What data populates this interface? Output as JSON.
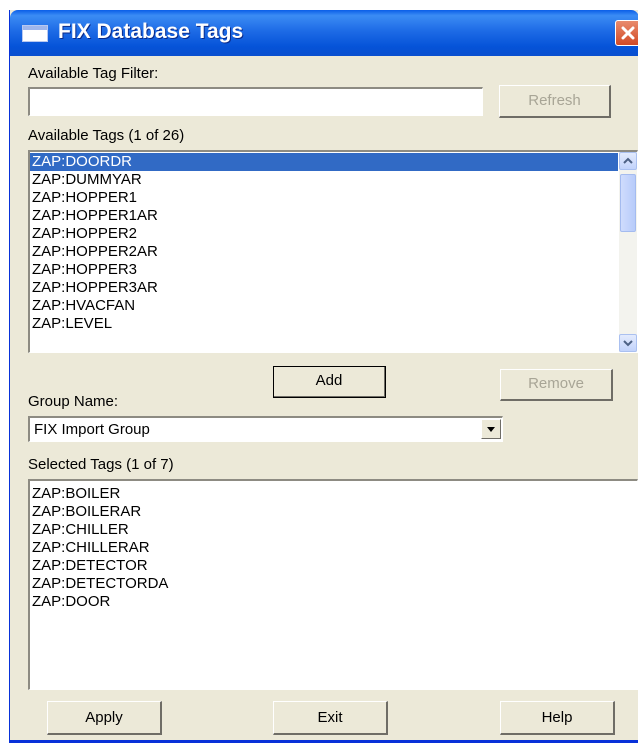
{
  "window": {
    "title": "FIX Database Tags",
    "icon": "window-icon",
    "close_icon": "close-icon"
  },
  "filter": {
    "label": "Available Tag Filter:",
    "value": "",
    "placeholder": "",
    "refresh_label": "Refresh"
  },
  "available": {
    "label": "Available Tags (1 of 26)",
    "items": [
      {
        "label": "ZAP:DOORDR"
      },
      {
        "label": "ZAP:DUMMYAR"
      },
      {
        "label": "ZAP:HOPPER1"
      },
      {
        "label": "ZAP:HOPPER1AR"
      },
      {
        "label": "ZAP:HOPPER2"
      },
      {
        "label": "ZAP:HOPPER2AR"
      },
      {
        "label": "ZAP:HOPPER3"
      },
      {
        "label": "ZAP:HOPPER3AR"
      },
      {
        "label": "ZAP:HVACFAN"
      },
      {
        "label": "ZAP:LEVEL"
      }
    ],
    "selected_index": 0,
    "scroll_icons": [
      "scroll-up-icon",
      "scroll-down-icon"
    ]
  },
  "buttons": {
    "add_label": "Add",
    "remove_label": "Remove",
    "apply_label": "Apply",
    "exit_label": "Exit",
    "help_label": "Help"
  },
  "group": {
    "label": "Group Name:",
    "value": "FIX Import Group"
  },
  "selected": {
    "label": "Selected Tags (1 of 7)",
    "items": [
      {
        "label": "ZAP:BOILER"
      },
      {
        "label": "ZAP:BOILERAR"
      },
      {
        "label": "ZAP:CHILLER"
      },
      {
        "label": "ZAP:CHILLERAR"
      },
      {
        "label": "ZAP:DETECTOR"
      },
      {
        "label": "ZAP:DETECTORDA"
      },
      {
        "label": "ZAP:DOOR"
      }
    ]
  },
  "colors": {
    "titlebar": "#0553d8",
    "selection": "#316ac5",
    "dialog_bg": "#ece9d8",
    "close_button": "#d24a26"
  }
}
